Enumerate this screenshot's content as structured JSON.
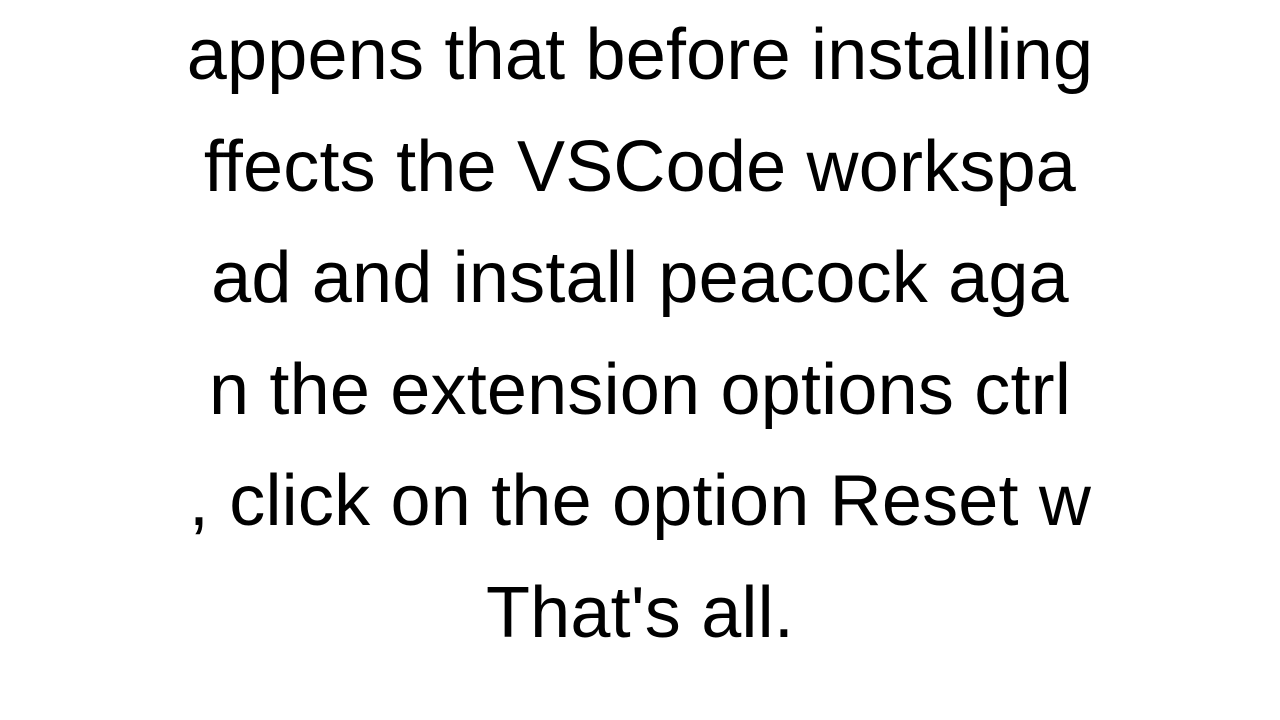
{
  "text": {
    "line1": "appens that before installing",
    "line2": "ffects the VSCode workspa",
    "line3": "ad and install peacock aga",
    "line4": "n the extension options ctrl ",
    "line5": ", click on the option Reset w",
    "line6": "That's all."
  }
}
